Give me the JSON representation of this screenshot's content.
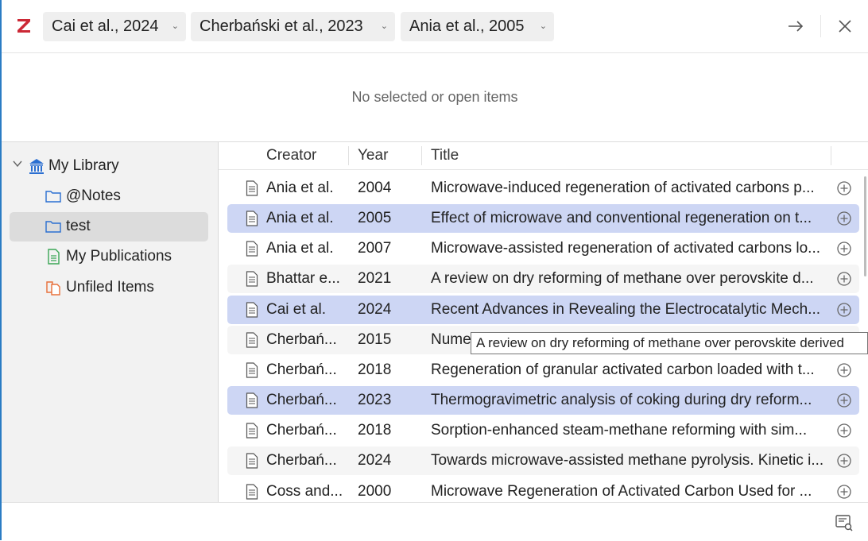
{
  "tabs": [
    {
      "label": "Cai et al., 2024"
    },
    {
      "label": "Cherbański et al., 2023"
    },
    {
      "label": "Ania et al., 2005"
    }
  ],
  "empty_message": "No selected or open items",
  "sidebar": {
    "items": [
      {
        "label": "My Library",
        "icon": "library-icon"
      },
      {
        "label": "@Notes",
        "icon": "folder-icon"
      },
      {
        "label": "test",
        "icon": "folder-icon"
      },
      {
        "label": "My Publications",
        "icon": "publications-icon"
      },
      {
        "label": "Unfiled Items",
        "icon": "unfiled-icon"
      }
    ]
  },
  "columns": {
    "creator": "Creator",
    "year": "Year",
    "title": "Title"
  },
  "rows": [
    {
      "creator": "Ania et al.",
      "year": "2004",
      "title": "Microwave-induced regeneration of activated carbons p...",
      "state": "normal"
    },
    {
      "creator": "Ania et al.",
      "year": "2005",
      "title": "Effect of microwave and conventional regeneration on t...",
      "state": "selected"
    },
    {
      "creator": "Ania et al.",
      "year": "2007",
      "title": "Microwave-assisted regeneration of activated carbons lo...",
      "state": "normal"
    },
    {
      "creator": "Bhattar e...",
      "year": "2021",
      "title": "A review on dry reforming of methane over perovskite d...",
      "state": "alt"
    },
    {
      "creator": "Cai et al.",
      "year": "2024",
      "title": "Recent Advances in Revealing the Electrocatalytic Mech...",
      "state": "selected"
    },
    {
      "creator": "Cherbań...",
      "year": "2015",
      "title": "Nume",
      "state": "alt"
    },
    {
      "creator": "Cherbań...",
      "year": "2018",
      "title": "Regeneration of granular activated carbon loaded with t...",
      "state": "normal"
    },
    {
      "creator": "Cherbań...",
      "year": "2023",
      "title": "Thermogravimetric analysis of coking during dry reform...",
      "state": "selected"
    },
    {
      "creator": "Cherbań...",
      "year": "2018",
      "title": "Sorption-enhanced steam-methane reforming with sim...",
      "state": "normal"
    },
    {
      "creator": "Cherbań...",
      "year": "2024",
      "title": "Towards microwave-assisted methane pyrolysis. Kinetic i...",
      "state": "alt"
    },
    {
      "creator": "Coss and...",
      "year": "2000",
      "title": "Microwave Regeneration of Activated Carbon Used for ...",
      "state": "normal"
    }
  ],
  "tooltip": "A review on dry reforming of methane over perovskite derived",
  "colors": {
    "accent": "#2b7cc4",
    "selection": "#cdd6f4",
    "zotero_red": "#cc2936"
  }
}
